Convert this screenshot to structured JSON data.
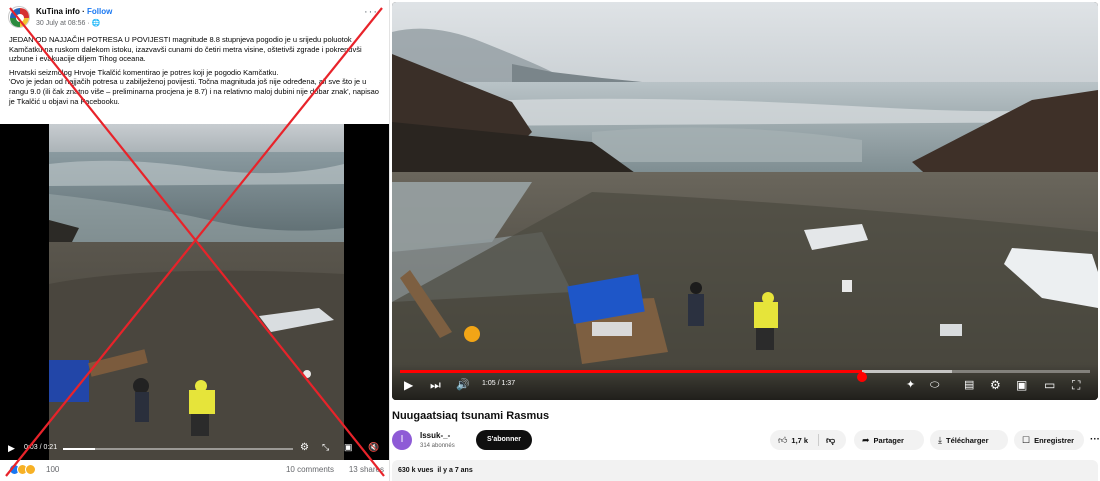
{
  "facebook": {
    "page_name": "KuTina info",
    "follow_label": "Follow",
    "separator": " · ",
    "date": "30 July at 08:56 ·",
    "more_label": "···",
    "paragraphs": [
      "JEDAN OD NAJJAČIH POTRESA U POVIJESTI magnitude 8.8 stupnjeva pogodio je u srijedu poluotok Kamčatku na ruskom dalekom istoku, izazvavši cunami do četiri metra visine, oštetivši zgrade i pokrenuvši uzbune i evakuacije diljem Tihog oceana.",
      "Hrvatski seizmolog Hrvoje Tkalčić komentirao je potres koji je pogodio Kamčatku.",
      "'Ovo je jedan od najjačih potresa u zabilježenoj povijesti. Točna magnituda još nije određena, ali sve što je u rangu 9.0 (ili čak znatno više – preliminarna procjena je 8.7) i na relativno maloj dubini nije dobar znak', napisao je Tkalčić u objavi na Facebooku."
    ],
    "video": {
      "time": "0:03 / 0:21",
      "progress_fraction": 0.14
    },
    "reaction_count": "100",
    "comments": "10 comments",
    "shares": "13 shares",
    "cross_color": "#e8232a"
  },
  "youtube": {
    "video": {
      "time": "1:05 / 1:37",
      "progress_fraction": 0.67,
      "buffered_fraction": 0.8
    },
    "title": "Nuugaatsiaq tsunami Rasmus",
    "channel": {
      "avatar_letter": "I",
      "name": "Issuk-_-",
      "subscribers": "314 abonnés",
      "subscribe_label": "S'abonner"
    },
    "actions": {
      "likes": "1,7 k",
      "share_label": "Partager",
      "download_label": "Télécharger",
      "save_label": "Enregistrer",
      "more_label": "···"
    },
    "views": "630 k vues",
    "age": "il y a 7 ans",
    "accent_color": "#ff0000"
  }
}
